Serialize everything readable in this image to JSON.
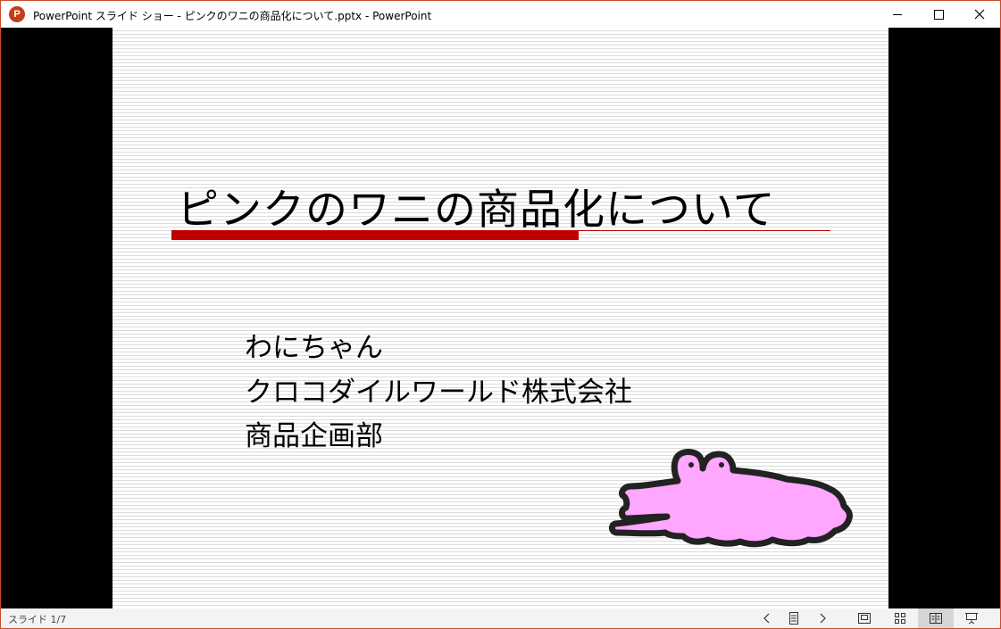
{
  "window": {
    "title": "PowerPoint スライド ショー  -  ピンクのワニの商品化について.pptx - PowerPoint",
    "app_icon_letter": "P",
    "accent_color": "#c43e1c"
  },
  "slide": {
    "title": "ピンクのワニの商品化について",
    "subtitle_lines": [
      "わにちゃん",
      "クロコダイルワールド株式会社",
      "商品企画部"
    ],
    "title_rule_color": "#c00000",
    "illustration": "pink-crocodile",
    "illustration_color": "#ffa6ff"
  },
  "statusbar": {
    "slide_indicator": "スライド 1/7",
    "controls": [
      "previous-slide",
      "slide-list",
      "next-slide",
      "normal-view",
      "slide-sorter-view",
      "reading-view",
      "slide-show-view"
    ]
  }
}
